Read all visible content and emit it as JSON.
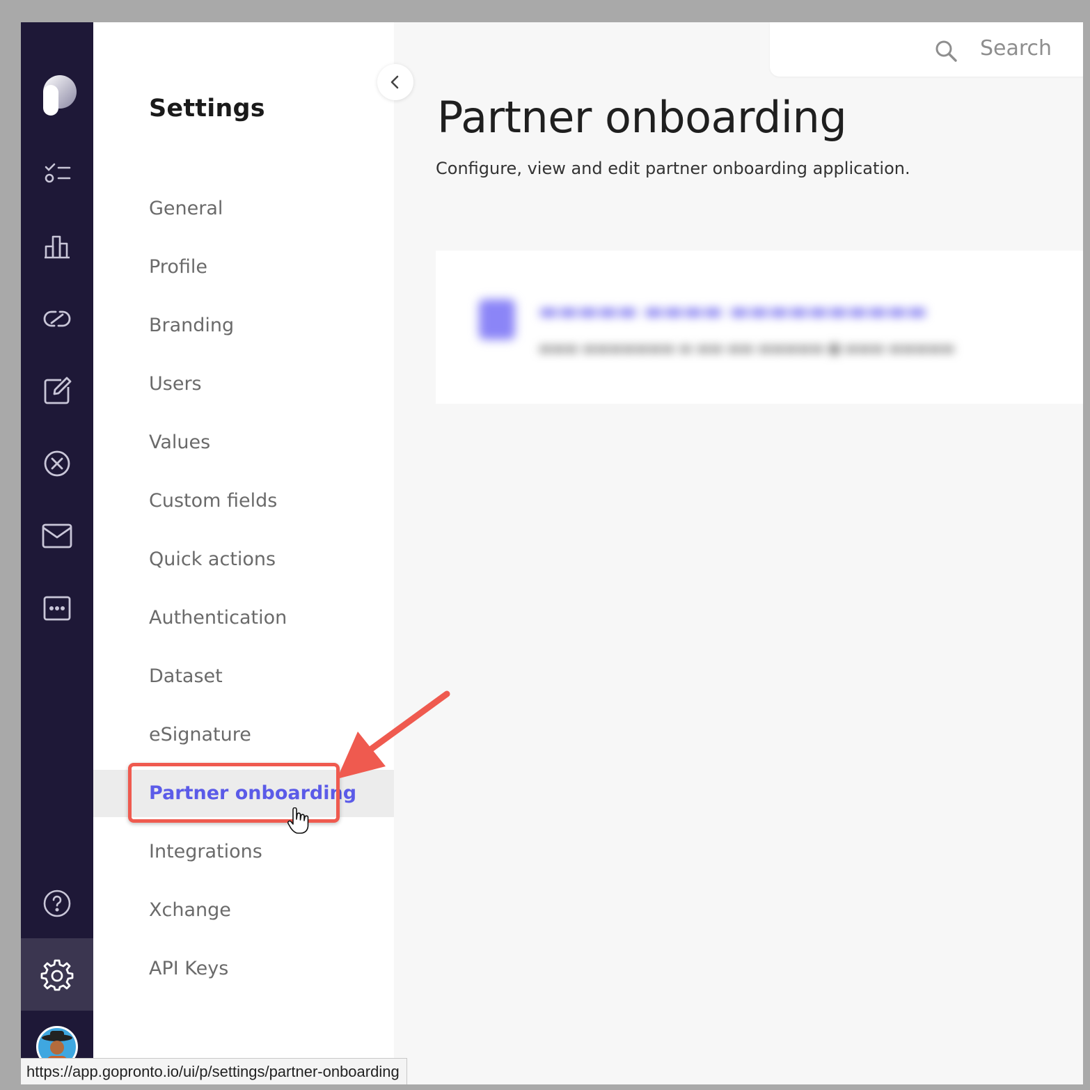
{
  "sidebar_rail": {
    "icons": [
      "logo-icon",
      "tasks-icon",
      "analytics-icon",
      "integrations-link-icon",
      "edit-icon",
      "cancel-circle-icon",
      "mail-icon",
      "more-icon",
      "help-icon",
      "gear-icon",
      "user-avatar"
    ]
  },
  "settings": {
    "title": "Settings",
    "items": [
      {
        "label": "General"
      },
      {
        "label": "Profile"
      },
      {
        "label": "Branding"
      },
      {
        "label": "Users"
      },
      {
        "label": "Values"
      },
      {
        "label": "Custom fields"
      },
      {
        "label": "Quick actions"
      },
      {
        "label": "Authentication"
      },
      {
        "label": "Dataset"
      },
      {
        "label": "eSignature"
      },
      {
        "label": "Partner onboarding",
        "active": true
      },
      {
        "label": "Integrations"
      },
      {
        "label": "Xchange"
      },
      {
        "label": "API Keys"
      }
    ]
  },
  "search": {
    "label": "Search"
  },
  "main": {
    "title": "Partner onboarding",
    "subtitle": "Configure, view and edit partner onboarding application."
  },
  "status_bar": {
    "url": "https://app.gopronto.io/ui/p/settings/partner-onboarding"
  },
  "colors": {
    "rail_bg": "#1e1837",
    "accent": "#5b5be8",
    "annotation": "#ef5a4f"
  }
}
